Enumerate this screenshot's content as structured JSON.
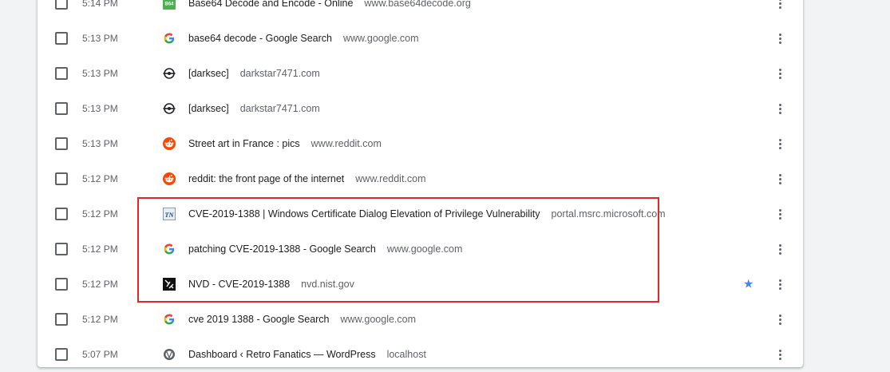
{
  "history": {
    "rows": [
      {
        "time": "5:14 PM",
        "title": "Base64 Decode and Encode - Online",
        "domain": "www.base64decode.org",
        "icon": "b64-icon",
        "starred": false
      },
      {
        "time": "5:13 PM",
        "title": "base64 decode - Google Search",
        "domain": "www.google.com",
        "icon": "google-icon",
        "starred": false
      },
      {
        "time": "5:13 PM",
        "title": "[darksec]",
        "domain": "darkstar7471.com",
        "icon": "darksec-icon",
        "starred": false
      },
      {
        "time": "5:13 PM",
        "title": "[darksec]",
        "domain": "darkstar7471.com",
        "icon": "darksec-icon",
        "starred": false
      },
      {
        "time": "5:13 PM",
        "title": "Street art in France : pics",
        "domain": "www.reddit.com",
        "icon": "reddit-icon",
        "starred": false
      },
      {
        "time": "5:12 PM",
        "title": "reddit: the front page of the internet",
        "domain": "www.reddit.com",
        "icon": "reddit-icon",
        "starred": false
      },
      {
        "time": "5:12 PM",
        "title": "CVE-2019-1388 | Windows Certificate Dialog Elevation of Privilege Vulnerability",
        "domain": "portal.msrc.microsoft.com",
        "icon": "technet-icon",
        "starred": false
      },
      {
        "time": "5:12 PM",
        "title": "patching CVE-2019-1388 - Google Search",
        "domain": "www.google.com",
        "icon": "google-icon",
        "starred": false
      },
      {
        "time": "5:12 PM",
        "title": "NVD - CVE-2019-1388",
        "domain": "nvd.nist.gov",
        "icon": "nvd-icon",
        "starred": true
      },
      {
        "time": "5:12 PM",
        "title": "cve 2019 1388 - Google Search",
        "domain": "www.google.com",
        "icon": "google-icon",
        "starred": false
      },
      {
        "time": "5:07 PM",
        "title": "Dashboard ‹ Retro Fanatics — WordPress",
        "domain": "localhost",
        "icon": "wordpress-icon",
        "starred": false
      }
    ]
  },
  "colors": {
    "highlight": "#e02828",
    "star": "#4285f4",
    "reddit": "#ff4500",
    "b64": "#4caf50"
  }
}
